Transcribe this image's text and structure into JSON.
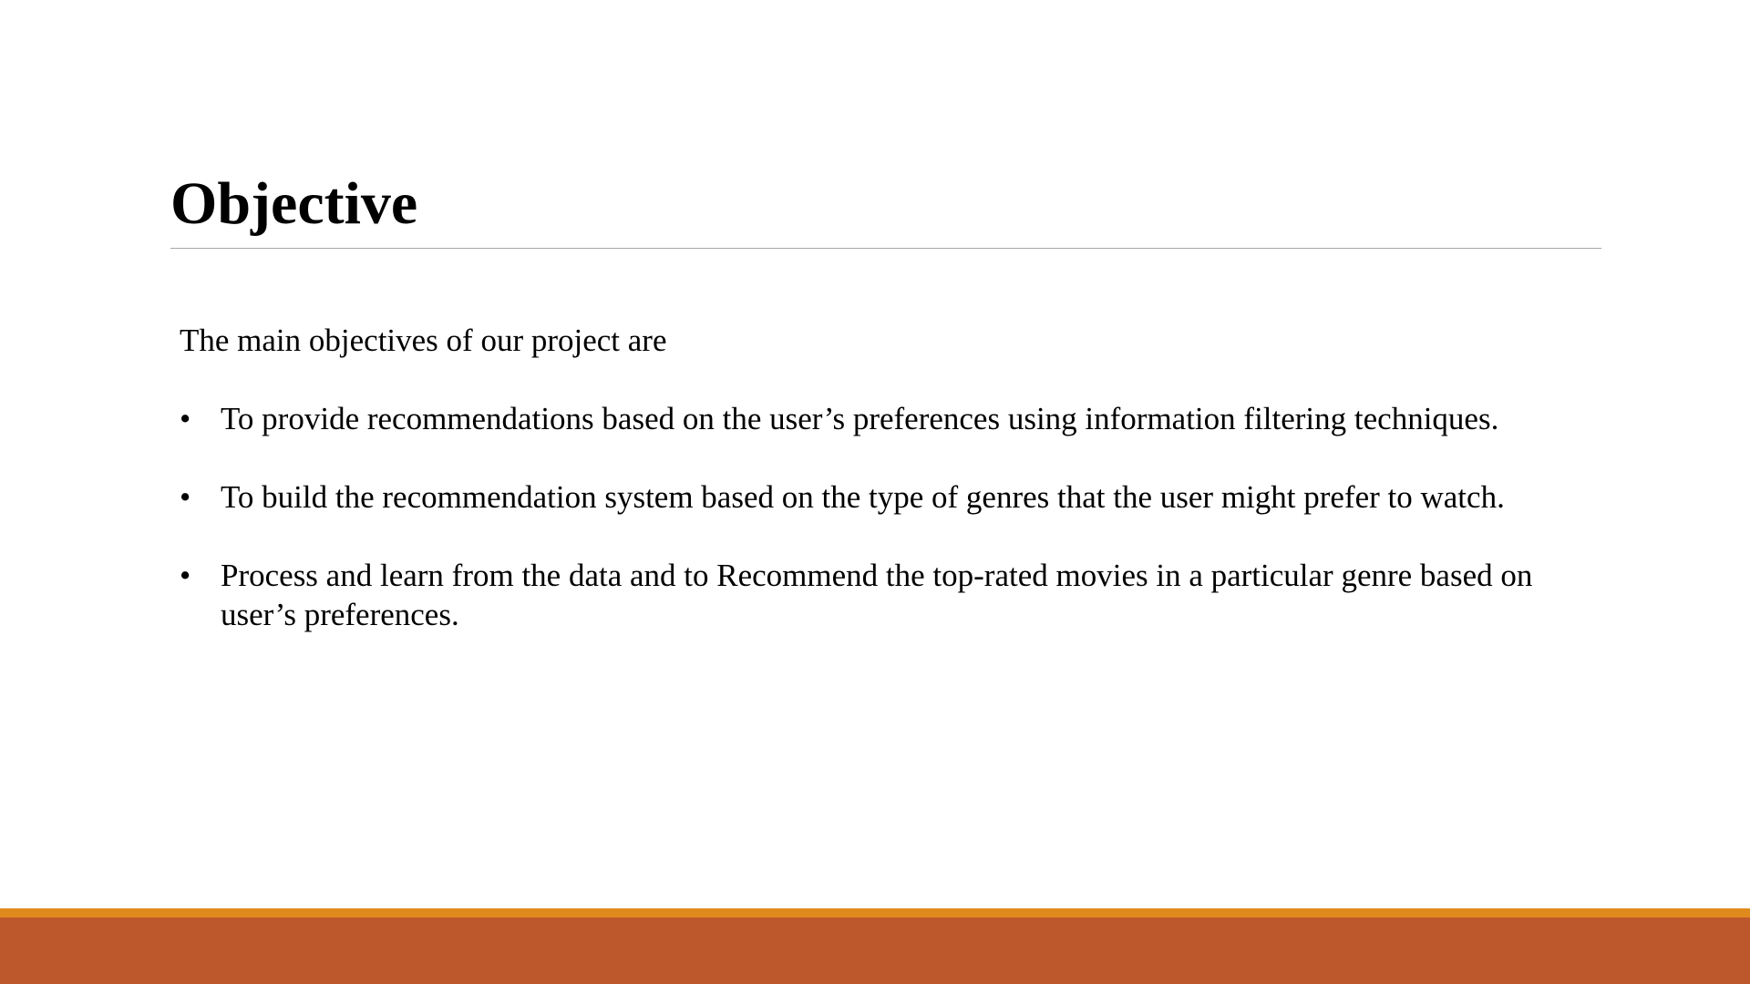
{
  "slide": {
    "title": "Objective",
    "intro": "The main objectives of  our project are",
    "bullet_glyph": "•",
    "bullets": [
      "To provide recommendations based on the user’s preferences using information filtering techniques.",
      "To build the recommendation system based on the type of genres that the user might prefer to watch.",
      "Process and learn from the data and to Recommend the top-rated movies in a particular genre based on user’s preferences."
    ]
  },
  "colors": {
    "background": "#ffffff",
    "title_rule": "#a6a6a6",
    "footer_accent": "#e08a1e",
    "footer_band": "#bc582c"
  }
}
